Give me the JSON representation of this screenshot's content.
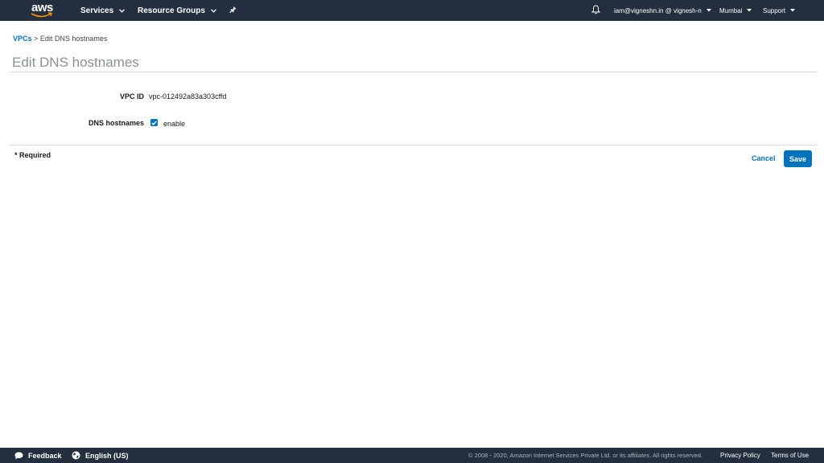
{
  "topnav": {
    "logo_text": "aws",
    "services_label": "Services",
    "resource_groups_label": "Resource Groups",
    "account_label": "iam@vigneshn.in @ vignesh-n",
    "region_label": "Mumbai",
    "support_label": "Support",
    "icons": [
      "aws-logo",
      "chevron-down-icon",
      "pin-icon",
      "bell-icon"
    ]
  },
  "breadcrumb": {
    "root": "VPCs",
    "separator": ">",
    "current": "Edit DNS hostnames"
  },
  "page": {
    "title": "Edit DNS hostnames"
  },
  "form": {
    "vpc_id_label": "VPC ID",
    "vpc_id_value": "vpc-012492a83a303cffd",
    "dns_hostnames_label": "DNS hostnames",
    "dns_hostnames_checked": true,
    "dns_hostnames_option": "enable",
    "required_note": "* Required"
  },
  "actions": {
    "cancel_label": "Cancel",
    "save_label": "Save"
  },
  "footer": {
    "feedback_label": "Feedback",
    "language_label": "English (US)",
    "copyright": "© 2008 - 2020, Amazon Internet Services Private Ltd. or its affiliates. All rights reserved.",
    "privacy_label": "Privacy Policy",
    "terms_label": "Terms of Use"
  },
  "colors": {
    "nav_bg": "#232f3e",
    "link_blue": "#0073bb",
    "title_gray": "#879196",
    "logo_orange": "#ff9900"
  }
}
